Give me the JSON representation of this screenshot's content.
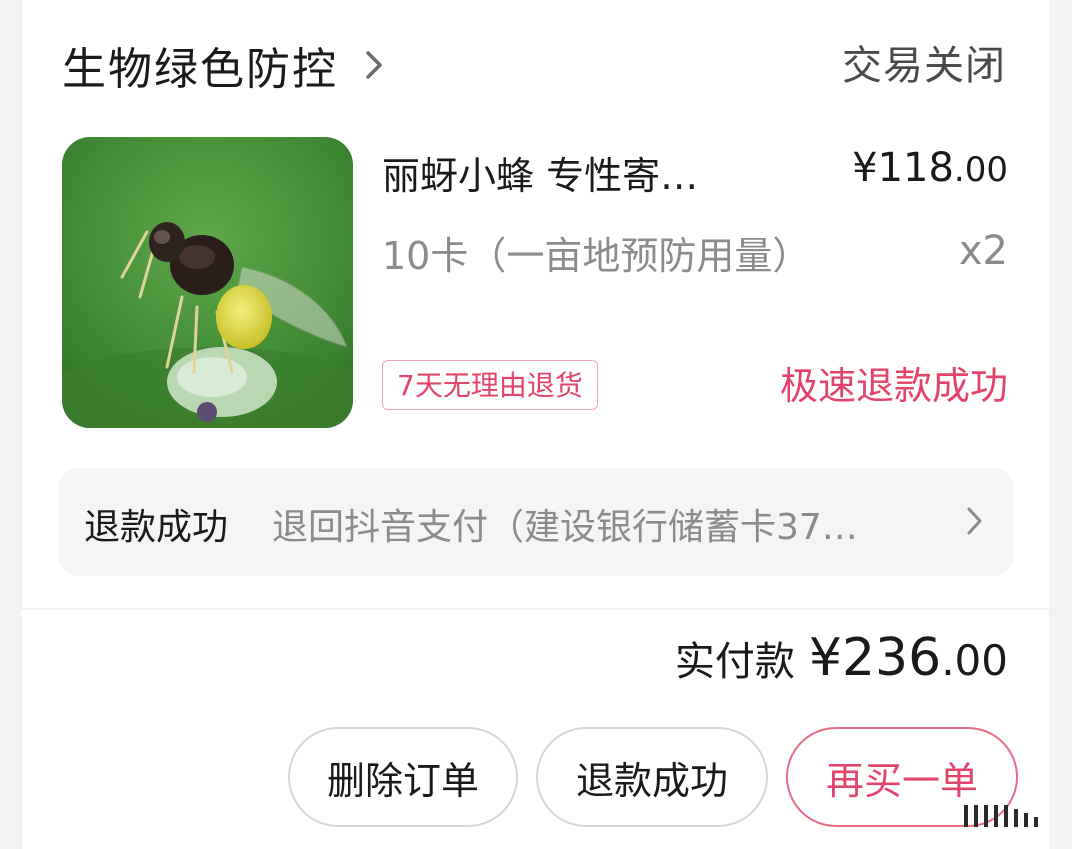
{
  "shop": {
    "name": "生物绿色防控"
  },
  "order": {
    "status": "交易关闭"
  },
  "product": {
    "title": "丽蚜小蜂 专性寄…",
    "price_main": "¥118",
    "price_cents": ".00",
    "spec": "10卡（一亩地预防用量）",
    "quantity": "x2",
    "tag": "7天无理由退货",
    "refund_status": "极速退款成功",
    "image_icon": "wasp-photo"
  },
  "refund": {
    "label": "退款成功",
    "description": "退回抖音支付（建设银行储蓄卡37…"
  },
  "total": {
    "label": "实付款",
    "amount_main": "¥236",
    "amount_cents": ".00"
  },
  "actions": {
    "delete_label": "删除订单",
    "refund_label": "退款成功",
    "rebuy_label": "再买一单"
  },
  "colors": {
    "accent_pink": "#e2446a",
    "tag_border": "#f0a5b3",
    "muted_text": "#8b8b8b"
  }
}
